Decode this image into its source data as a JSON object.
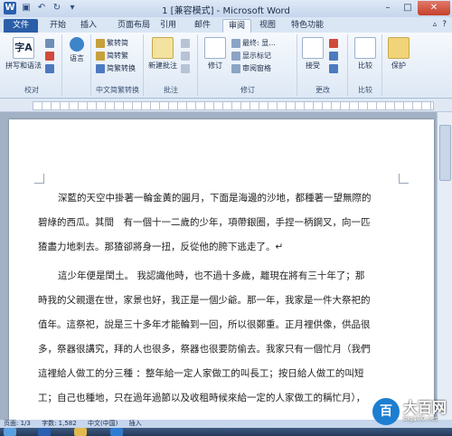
{
  "window": {
    "title": "1 [兼容模式] - Microsoft Word"
  },
  "tabs": {
    "file": "文件",
    "items": [
      "开始",
      "插入",
      "页面布局",
      "引用",
      "邮件",
      "审阅",
      "视图",
      "特色功能"
    ],
    "active": "审阅"
  },
  "ribbon": {
    "proofing": {
      "label": "校对",
      "spelling": "拼写和语法"
    },
    "language": {
      "label": "语言"
    },
    "chinese_conversion": {
      "label": "中文简繁转换",
      "to_simplified": "繁转简",
      "to_traditional": "简转繁",
      "convert": "简繁转换"
    },
    "comments": {
      "label": "批注",
      "new_comment": "新建批注"
    },
    "tracking": {
      "label": "修订",
      "track_changes": "修订",
      "display": "最终: 显...",
      "show_markup": "显示标记",
      "reviewing_pane": "审阅窗格"
    },
    "changes": {
      "label": "更改",
      "accept": "接受"
    },
    "compare": {
      "label": "比较",
      "compare": "比较"
    },
    "protect": {
      "label": "保护"
    }
  },
  "document": {
    "paragraphs": [
      "深藍的天空中掛著一輪金黃的圓月，下面是海邊的沙地，都種著一望無際的",
      "碧綠的西瓜。其間　有一個十一二歲的少年，項帶銀圈，手捏一柄鋼叉，向一匹",
      "猹盡力地刺去。那猹卻將身一扭，反從他的胯下逃走了。↵",
      "這少年便是閏土。  我認識他時，也不過十多歲，離現在將有三十年了；那",
      "時我的父親還在世，家景也好，我正是一個少爺。那一年，我家是一件大祭祀的",
      "值年。這祭祀，說是三十多年才能輪到一回，所以很鄭重。正月裡供像，供品很",
      "多，祭器很講究，拜的人也很多，祭器也很要防偷去。我家只有一個忙月（我們",
      "這裡給人做工的分三種 ：整年給一定人家做工的叫長工；按日給人做工的叫短",
      "工；自己也種地，只在過年過節以及收租時候來給一定的人家做工的稱忙月），"
    ]
  },
  "status_bar": {
    "page": "页面: 1/3",
    "words": "字数: 1,582",
    "lang": "中文(中国)",
    "mode": "插入"
  },
  "watermark": {
    "brand": "大百网",
    "url": "big100.net"
  }
}
